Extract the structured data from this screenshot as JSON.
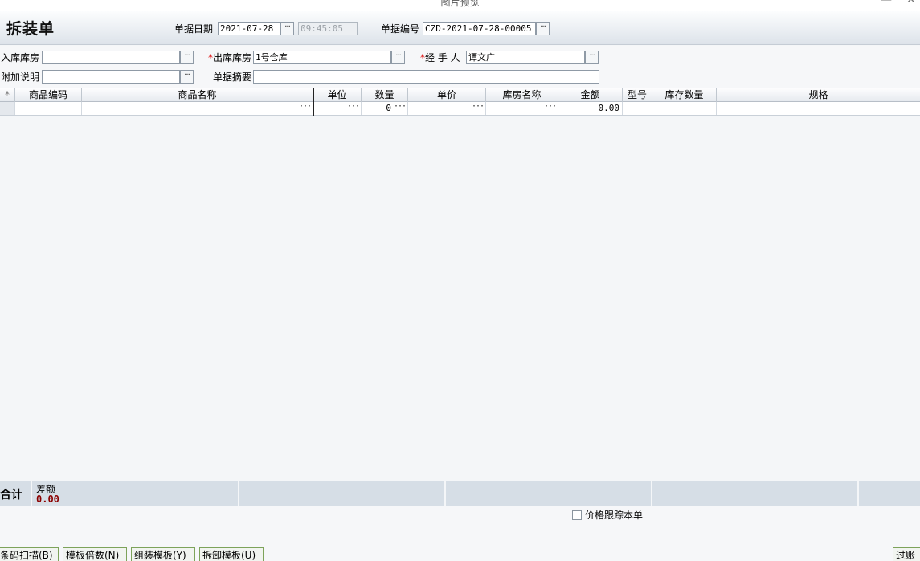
{
  "window": {
    "title": "图片预览",
    "min_glyph": "—",
    "close_glyph": "✕"
  },
  "header": {
    "title": "拆装单",
    "date_label": "单据日期",
    "date_value": "2021-07-28",
    "time_value": "09:45:05",
    "number_label": "单据编号",
    "number_value": "CZD-2021-07-28-00005"
  },
  "form": {
    "in_warehouse_label": "入库库房",
    "in_warehouse_value": "",
    "out_warehouse_label": "出库库房",
    "out_warehouse_value": "1号仓库",
    "handler_label": "经 手 人",
    "handler_value": "谭文广",
    "note_label": "附加说明",
    "note_value": "",
    "summary_label": "单据摘要",
    "summary_value": "",
    "required_mark": "*",
    "ellipsis": "···"
  },
  "grid": {
    "columns": [
      "*",
      "商品编码",
      "商品名称",
      "单位",
      "数量",
      "单价",
      "库房名称",
      "金额",
      "型号",
      "库存数量",
      "规格"
    ],
    "row": {
      "quantity": "0",
      "amount": "0.00"
    }
  },
  "footer": {
    "total_label": "合计",
    "diff_label": "差额",
    "diff_value": "0.00",
    "price_track_label": "价格跟踪本单",
    "price_track_checked": false
  },
  "buttons": {
    "barcode": "条码扫描(B)",
    "template_multiple": "模板倍数(N)",
    "assembly_template": "组装模板(Y)",
    "disassembly_template": "拆卸模板(U)",
    "post": "过账"
  },
  "colors": {
    "diff_value": "#8b0000",
    "required": "#dd0000",
    "button_border": "#7da35a"
  }
}
